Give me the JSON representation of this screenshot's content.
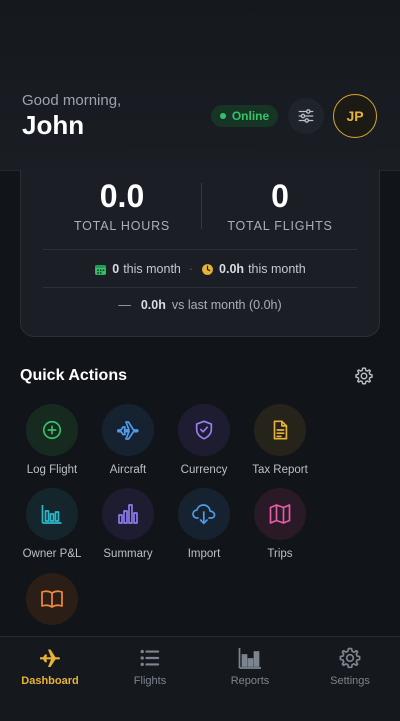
{
  "header": {
    "greeting": "Good morning,",
    "name": "John",
    "status": "Online",
    "avatar_initials": "JP",
    "filter_icon": "sliders-icon"
  },
  "stats": {
    "total_hours_value": "0.0",
    "total_hours_label": "TOTAL HOURS",
    "total_flights_value": "0",
    "total_flights_label": "TOTAL FLIGHTS",
    "flights_this_month_count": "0",
    "flights_this_month_text": "this month",
    "hours_this_month_value": "0.0h",
    "hours_this_month_text": "this month",
    "compare_dash": "—",
    "compare_value": "0.0h",
    "compare_text": "vs last month (0.0h)"
  },
  "quick_actions": {
    "title": "Quick Actions",
    "items": [
      {
        "label": "Log Flight",
        "icon": "plus-circle-icon",
        "color": "#34c26b"
      },
      {
        "label": "Aircraft",
        "icon": "airplane-icon",
        "color": "#4f9be8"
      },
      {
        "label": "Currency",
        "icon": "shield-check-icon",
        "color": "#9a7ef0"
      },
      {
        "label": "Tax Report",
        "icon": "document-icon",
        "color": "#e6b335"
      },
      {
        "label": "Owner P&L",
        "icon": "bar-chart-icon",
        "color": "#2cb8c9"
      },
      {
        "label": "Summary",
        "icon": "column-chart-icon",
        "color": "#8b7cf0"
      },
      {
        "label": "Import",
        "icon": "cloud-download-icon",
        "color": "#4f9be8"
      },
      {
        "label": "Trips",
        "icon": "map-icon",
        "color": "#e45ca8"
      },
      {
        "label": "",
        "icon": "book-icon",
        "color": "#f08a3c"
      }
    ]
  },
  "nav": {
    "items": [
      {
        "label": "Dashboard",
        "icon": "airplane-icon",
        "active": true
      },
      {
        "label": "Flights",
        "icon": "list-icon",
        "active": false
      },
      {
        "label": "Reports",
        "icon": "bar-chart-icon",
        "active": false
      },
      {
        "label": "Settings",
        "icon": "gear-icon",
        "active": false
      }
    ]
  },
  "colors": {
    "accent": "#e6b335",
    "online": "#34c26b",
    "background": "#111418"
  }
}
